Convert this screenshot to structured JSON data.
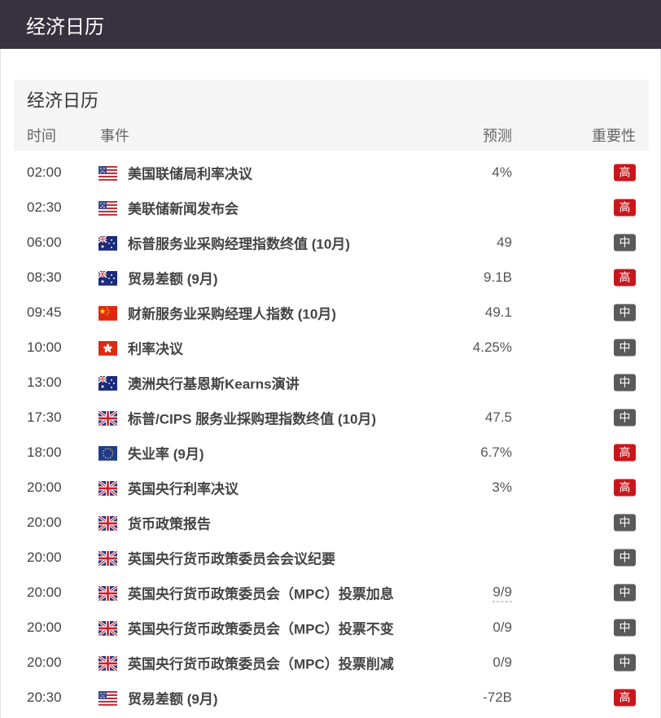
{
  "header": {
    "title": "经济日历"
  },
  "panel": {
    "title": "经济日历",
    "columns": {
      "time": "时间",
      "event": "事件",
      "forecast": "预测",
      "importance": "重要性"
    }
  },
  "rows": [
    {
      "time": "02:00",
      "flag": "us",
      "event": "美国联储局利率决议",
      "forecast": "4%",
      "importance": "高",
      "level": "high"
    },
    {
      "time": "02:30",
      "flag": "us",
      "event": "美联储新闻发布会",
      "forecast": "",
      "importance": "高",
      "level": "high"
    },
    {
      "time": "06:00",
      "flag": "au",
      "event": "标普服务业采购经理指数终值 (10月)",
      "forecast": "49",
      "importance": "中",
      "level": "mid"
    },
    {
      "time": "08:30",
      "flag": "au",
      "event": "贸易差额 (9月)",
      "forecast": "9.1B",
      "importance": "高",
      "level": "high"
    },
    {
      "time": "09:45",
      "flag": "cn",
      "event": "财新服务业采购经理人指数 (10月)",
      "forecast": "49.1",
      "importance": "中",
      "level": "mid"
    },
    {
      "time": "10:00",
      "flag": "hk",
      "event": "利率决议",
      "forecast": "4.25%",
      "importance": "中",
      "level": "mid"
    },
    {
      "time": "13:00",
      "flag": "au",
      "event": "澳洲央行基恩斯Kearns演讲",
      "forecast": "",
      "importance": "中",
      "level": "mid"
    },
    {
      "time": "17:30",
      "flag": "uk",
      "event": "标普/CIPS 服务业採购理指数终值 (10月)",
      "forecast": "47.5",
      "importance": "中",
      "level": "mid"
    },
    {
      "time": "18:00",
      "flag": "eu",
      "event": "失业率 (9月)",
      "forecast": "6.7%",
      "importance": "高",
      "level": "high"
    },
    {
      "time": "20:00",
      "flag": "uk",
      "event": "英国央行利率决议",
      "forecast": "3%",
      "importance": "高",
      "level": "high"
    },
    {
      "time": "20:00",
      "flag": "uk",
      "event": "货币政策报告",
      "forecast": "",
      "importance": "中",
      "level": "mid"
    },
    {
      "time": "20:00",
      "flag": "uk",
      "event": "英国央行货币政策委员会会议纪要",
      "forecast": "",
      "importance": "中",
      "level": "mid"
    },
    {
      "time": "20:00",
      "flag": "uk",
      "event": "英国央行货币政策委员会（MPC）投票加息",
      "forecast": "9/9",
      "importance": "中",
      "level": "mid",
      "dashed": true
    },
    {
      "time": "20:00",
      "flag": "uk",
      "event": "英国央行货币政策委员会（MPC）投票不变",
      "forecast": "0/9",
      "importance": "中",
      "level": "mid"
    },
    {
      "time": "20:00",
      "flag": "uk",
      "event": "英国央行货币政策委员会（MPC）投票削减",
      "forecast": "0/9",
      "importance": "中",
      "level": "mid"
    },
    {
      "time": "20:30",
      "flag": "us",
      "event": "贸易差额 (9月)",
      "forecast": "-72B",
      "importance": "高",
      "level": "high"
    }
  ]
}
